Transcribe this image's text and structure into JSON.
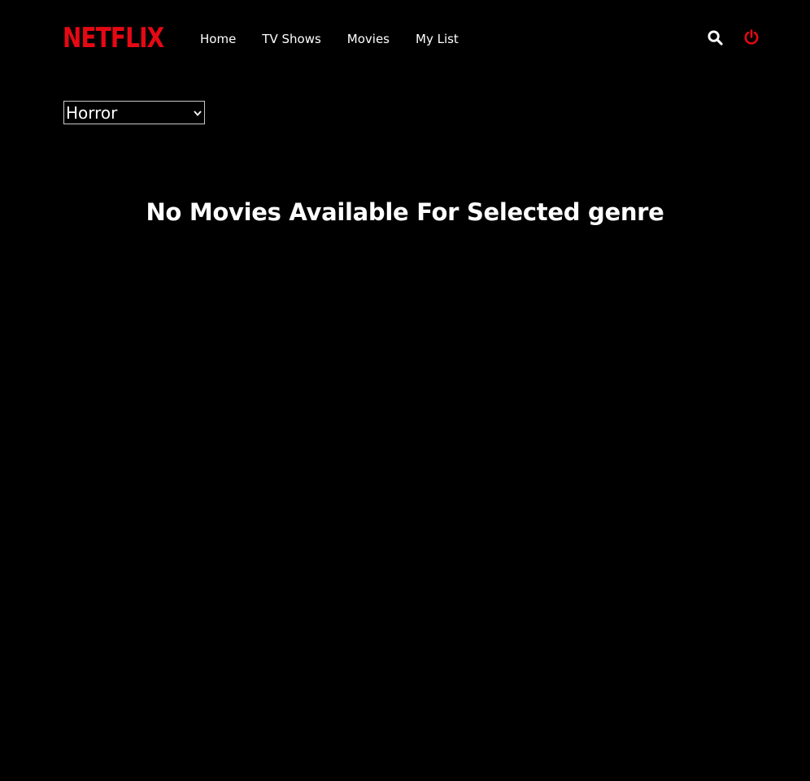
{
  "brand": {
    "logo_text": "NETFLIX",
    "logo_color": "#e50914"
  },
  "nav": {
    "links": [
      {
        "label": "Home"
      },
      {
        "label": "TV Shows"
      },
      {
        "label": "Movies"
      },
      {
        "label": "My List"
      }
    ],
    "icons": {
      "search": "search-icon",
      "power": "power-icon",
      "power_color": "#e50914"
    }
  },
  "filter": {
    "selected_genre": "Horror"
  },
  "main": {
    "empty_message": "No Movies Available For Selected genre"
  }
}
